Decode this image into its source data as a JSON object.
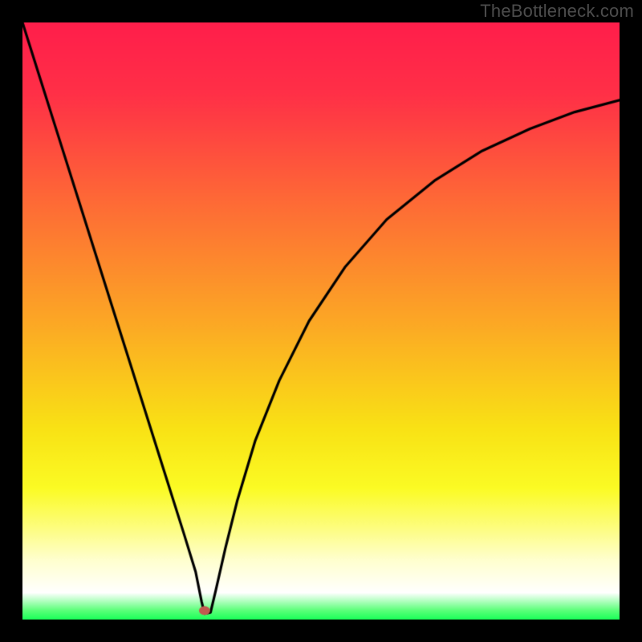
{
  "watermark": "TheBottleneck.com",
  "colors": {
    "background_black": "#000000",
    "curve_black": "#000000",
    "watermark_gray": "#4c4c4c",
    "gradient_stops": [
      {
        "pos": 0.0,
        "color": "#ff1e4b"
      },
      {
        "pos": 0.12,
        "color": "#ff3047"
      },
      {
        "pos": 0.3,
        "color": "#fe6a36"
      },
      {
        "pos": 0.5,
        "color": "#fca725"
      },
      {
        "pos": 0.68,
        "color": "#f9e215"
      },
      {
        "pos": 0.78,
        "color": "#fbfb24"
      },
      {
        "pos": 0.84,
        "color": "#fdfd76"
      },
      {
        "pos": 0.9,
        "color": "#ffffce"
      },
      {
        "pos": 0.955,
        "color": "#ffffff"
      },
      {
        "pos": 0.985,
        "color": "#5aff79"
      },
      {
        "pos": 1.0,
        "color": "#1aff59"
      }
    ],
    "minimum_dot": "#c1594f"
  },
  "chart_data": {
    "type": "line",
    "title": "",
    "xlabel": "",
    "ylabel": "",
    "xlim": [
      0,
      1
    ],
    "ylim": [
      0,
      1
    ],
    "x_min_point": 0.305,
    "curve": [
      {
        "x": 0.0,
        "y": 1.0
      },
      {
        "x": 0.03,
        "y": 0.905
      },
      {
        "x": 0.06,
        "y": 0.81
      },
      {
        "x": 0.09,
        "y": 0.715
      },
      {
        "x": 0.12,
        "y": 0.62
      },
      {
        "x": 0.15,
        "y": 0.525
      },
      {
        "x": 0.18,
        "y": 0.43
      },
      {
        "x": 0.21,
        "y": 0.335
      },
      {
        "x": 0.24,
        "y": 0.24
      },
      {
        "x": 0.27,
        "y": 0.145
      },
      {
        "x": 0.29,
        "y": 0.08
      },
      {
        "x": 0.3,
        "y": 0.03
      },
      {
        "x": 0.305,
        "y": 0.01
      },
      {
        "x": 0.315,
        "y": 0.012
      },
      {
        "x": 0.324,
        "y": 0.05
      },
      {
        "x": 0.34,
        "y": 0.12
      },
      {
        "x": 0.36,
        "y": 0.2
      },
      {
        "x": 0.39,
        "y": 0.3
      },
      {
        "x": 0.43,
        "y": 0.4
      },
      {
        "x": 0.48,
        "y": 0.5
      },
      {
        "x": 0.54,
        "y": 0.59
      },
      {
        "x": 0.61,
        "y": 0.67
      },
      {
        "x": 0.69,
        "y": 0.735
      },
      {
        "x": 0.77,
        "y": 0.785
      },
      {
        "x": 0.85,
        "y": 0.822
      },
      {
        "x": 0.925,
        "y": 0.85
      },
      {
        "x": 1.0,
        "y": 0.87
      }
    ],
    "minimum_marker": {
      "x": 0.305,
      "y": 0.015
    }
  }
}
